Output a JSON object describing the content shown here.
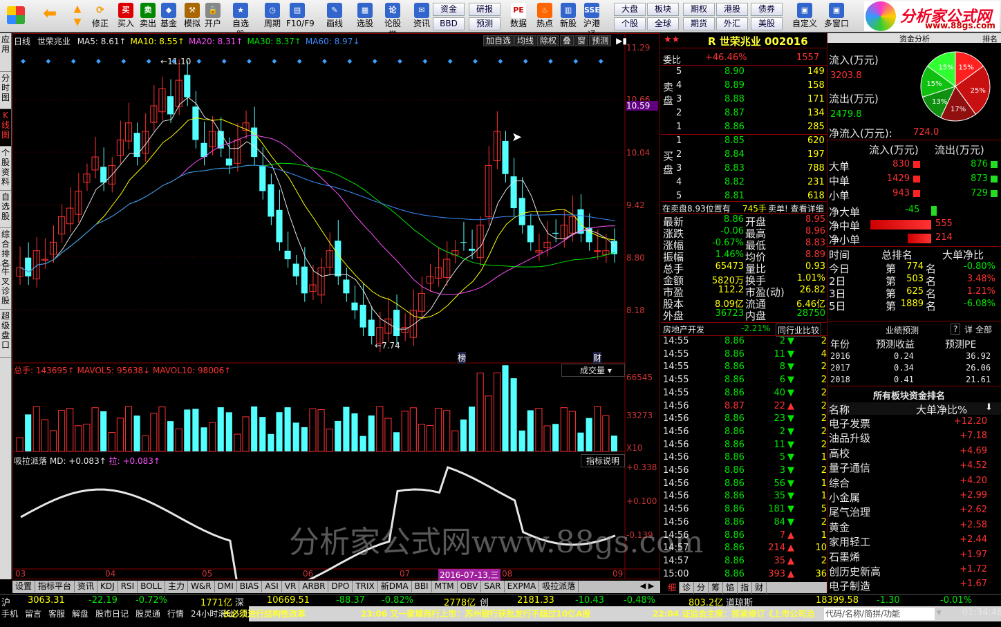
{
  "toolbar": {
    "buttons": [
      "买入",
      "卖出",
      "基金",
      "模拟",
      "开户",
      "自选股",
      "周期",
      "F10/F9",
      "画线",
      "选股",
      "论股堂",
      "资讯",
      "数据",
      "热点",
      "新股",
      "沪港通",
      "自定义",
      "多窗口"
    ],
    "back_label": "",
    "up": "",
    "fix": "修正",
    "small": [
      [
        "资金",
        "研报",
        "大盘",
        "板块",
        "期权",
        "港股",
        "债券"
      ],
      [
        "BBD",
        "预测",
        "个股",
        "全球",
        "期货",
        "外汇",
        "美股"
      ]
    ],
    "pe": "PE"
  },
  "logo": {
    "title": "分析家公式网",
    "url": "www.88gs.com"
  },
  "left_tabs": [
    "应用",
    "分时图",
    "K线图",
    "个股资料",
    "自选股",
    "综合排名",
    "牛叉诊股",
    "超级盘口"
  ],
  "chart": {
    "period": "日线",
    "name": "世荣兆业",
    "ma": [
      {
        "t": "MA5: 8.61↑",
        "c": "#e6e6e6"
      },
      {
        "t": "MA10: 8.55↑",
        "c": "#ffff00"
      },
      {
        "t": "MA20: 8.31↑",
        "c": "#ff50ff"
      },
      {
        "t": "MA30: 8.37↑",
        "c": "#00e600"
      },
      {
        "t": "MA60: 8.97↓",
        "c": "#3c8cff"
      }
    ],
    "top_btns": [
      "加自选",
      "均线",
      "除权",
      "叠",
      "窗",
      "预测"
    ],
    "yticks": [
      "11.29",
      "10.66",
      "10.59",
      "10.04",
      "9.42",
      "8.80",
      "8.18"
    ],
    "high": "11.10",
    "low": "7.74",
    "bang": "榜",
    "cai": "财",
    "vol_hdr": "总手: 143695↑ MAVOL5: 95638↓ MAVOL10: 98006↑",
    "vol_btn": "成交量",
    "vol_ticks": [
      "66545",
      "33273",
      "X10"
    ],
    "ind_hdr_name": "吸拉派落",
    "ind_md": "MD: +0.083↑",
    "ind_la": "拉: +0.083↑",
    "ind_btn": "指标说明",
    "ind_ticks": [
      "+0.338",
      "+0.100",
      "-0.139"
    ],
    "xticks": [
      "03",
      "04",
      "05",
      "06",
      "07",
      "08",
      "09"
    ],
    "cursor_date": "2016-07-13,三",
    "watermark": "分析家公式网www.88gs.com"
  },
  "quote": {
    "title": "世荣兆业",
    "code": "002016",
    "r": "R",
    "weibi_label": "委比",
    "weibi": "+46.46%",
    "weicha": "1557",
    "sell_label": "卖盘",
    "buy_label": "买盘",
    "sell": [
      [
        "5",
        "8.90",
        "149"
      ],
      [
        "4",
        "8.89",
        "158"
      ],
      [
        "3",
        "8.88",
        "171"
      ],
      [
        "2",
        "8.87",
        "134"
      ],
      [
        "1",
        "8.86",
        "285"
      ]
    ],
    "buy": [
      [
        "1",
        "8.85",
        "620"
      ],
      [
        "2",
        "8.84",
        "197"
      ],
      [
        "3",
        "8.83",
        "788"
      ],
      [
        "4",
        "8.82",
        "231"
      ],
      [
        "5",
        "8.81",
        "618"
      ]
    ],
    "note": "在卖盘8.93位置有",
    "note_amt": "745手",
    "note_tail": "卖单! 查看详细",
    "stats": [
      [
        "最新",
        "8.86",
        "开盘",
        "8.95"
      ],
      [
        "涨跌",
        "-0.06",
        "最高",
        "8.96"
      ],
      [
        "涨幅",
        "-0.67%",
        "最低",
        "8.83"
      ],
      [
        "振幅",
        "1.46%",
        "均价",
        "8.89"
      ],
      [
        "总手",
        "65473",
        "量比",
        "0.93"
      ],
      [
        "金额",
        "5820万",
        "换手",
        "1.01%"
      ],
      [
        "市盈",
        "112.2",
        "市盈(动)",
        "26.82"
      ],
      [
        "股本",
        "8.09亿",
        "流通",
        "6.46亿"
      ],
      [
        "外盘",
        "36723",
        "内盘",
        "28750"
      ]
    ],
    "industry": "房地产开发",
    "industry_chg": "-2.21%",
    "compare": "同行业比较",
    "ticks": [
      [
        "14:55",
        "8.86",
        "2",
        "d",
        "2"
      ],
      [
        "14:55",
        "8.86",
        "11",
        "d",
        "4"
      ],
      [
        "14:55",
        "8.86",
        "8",
        "d",
        "2"
      ],
      [
        "14:55",
        "8.86",
        "6",
        "d",
        "2"
      ],
      [
        "14:55",
        "8.86",
        "40",
        "d",
        "2"
      ],
      [
        "14:56",
        "8.87",
        "22",
        "u",
        "2"
      ],
      [
        "14:56",
        "8.86",
        "23",
        "d",
        "2"
      ],
      [
        "14:56",
        "8.86",
        "2",
        "d",
        "2"
      ],
      [
        "14:56",
        "8.86",
        "11",
        "d",
        "2"
      ],
      [
        "14:56",
        "8.86",
        "5",
        "d",
        "1"
      ],
      [
        "14:56",
        "8.86",
        "3",
        "d",
        "2"
      ],
      [
        "14:56",
        "8.86",
        "56",
        "d",
        "1"
      ],
      [
        "14:56",
        "8.86",
        "35",
        "d",
        "1"
      ],
      [
        "14:56",
        "8.86",
        "181",
        "d",
        "5"
      ],
      [
        "14:56",
        "8.86",
        "84",
        "d",
        "2"
      ],
      [
        "14:56",
        "8.86",
        "7",
        "u",
        "1"
      ],
      [
        "14:57",
        "8.86",
        "214",
        "u",
        "10"
      ],
      [
        "14:57",
        "8.86",
        "35",
        "u",
        "2"
      ],
      [
        "15:00",
        "8.86",
        "393",
        "u",
        "36"
      ]
    ],
    "bottom_tabs": [
      "细",
      "诊",
      "分",
      "筹",
      "馅",
      "指",
      "财"
    ]
  },
  "fund": {
    "title": "资金分析",
    "tab2": "排名",
    "in_label": "流入(万元)",
    "in_val": "3203.8",
    "out_label": "流出(万元)",
    "out_val": "2479.8",
    "net_label": "净流入(万元):",
    "net_val": "724.0",
    "pie": [
      {
        "v": 15,
        "c": "#ff2020"
      },
      {
        "v": 25,
        "c": "#c81010"
      },
      {
        "v": 17,
        "c": "#901010"
      },
      {
        "v": 13,
        "c": "#109010"
      },
      {
        "v": 15,
        "c": "#10c010"
      },
      {
        "v": 15,
        "c": "#30ff30"
      }
    ],
    "pie_labels": [
      "15%",
      "25%",
      "17%",
      "13%",
      "15%",
      "15%"
    ],
    "hdr_in": "流入(万元)",
    "hdr_out": "流出(万元)",
    "rows": [
      [
        "大单",
        "830",
        "876"
      ],
      [
        "中单",
        "1429",
        "873"
      ],
      [
        "小单",
        "943",
        "729"
      ]
    ],
    "net": [
      [
        "净大单",
        "-45"
      ],
      [
        "净中单",
        "555"
      ],
      [
        "净小单",
        "214"
      ]
    ],
    "rank_hdr": [
      "时间",
      "总排名",
      "大单净比"
    ],
    "rank": [
      [
        "今日",
        "第",
        "774",
        "名",
        "-0.80%"
      ],
      [
        "2日",
        "第",
        "503",
        "名",
        "3.48%"
      ],
      [
        "3日",
        "第",
        "625",
        "名",
        "1.21%"
      ],
      [
        "5日",
        "第",
        "1889",
        "名",
        "-6.08%"
      ]
    ],
    "forecast_title": "业绩预测",
    "fc_q": "?",
    "fc_d": "详",
    "fc_all": "全部",
    "fc_hdr": [
      "年份",
      "预测收益",
      "预测PE"
    ],
    "fc": [
      [
        "2016",
        "0.24",
        "36.92"
      ],
      [
        "2017",
        "0.34",
        "26.06"
      ],
      [
        "2018",
        "0.41",
        "21.61"
      ]
    ],
    "sector_title": "所有板块资金排名",
    "sector_hdr": [
      "名称",
      "大单净比%"
    ],
    "sectors": [
      [
        "电子发票",
        "+12.20"
      ],
      [
        "油品升级",
        "+7.18"
      ],
      [
        "高校",
        "+4.69"
      ],
      [
        "量子通信",
        "+4.52"
      ],
      [
        "综合",
        "+4.20"
      ],
      [
        "小金属",
        "+2.99"
      ],
      [
        "尾气治理",
        "+2.62"
      ],
      [
        "黄金",
        "+2.58"
      ],
      [
        "家用轻工",
        "+2.44"
      ],
      [
        "石墨烯",
        "+1.97"
      ],
      [
        "创历史新高",
        "+1.72"
      ],
      [
        "电子制造",
        "+1.67"
      ]
    ]
  },
  "bottom_tabs": [
    "设置",
    "指标平台",
    "资讯",
    "KDJ",
    "RSI",
    "BOLL",
    "主力",
    "W&R",
    "DMI",
    "BIAS",
    "ASI",
    "VR",
    "ARBR",
    "DPO",
    "TRIX",
    "新DMA",
    "BBI",
    "MTM",
    "OBV",
    "SAR",
    "EXPMA",
    "吸拉派落"
  ],
  "status": {
    "sh": "沪",
    "sh_v": "3063.31",
    "sh_c": "-22.19",
    "sh_p": "-0.72%",
    "sh_a": "1771亿",
    "sz": "深",
    "sz_v": "10669.51",
    "sz_c": "-88.37",
    "sz_p": "-0.82%",
    "sz_a": "2778亿",
    "cy": "创",
    "cy_v": "2181.33",
    "cy_c": "-10.43",
    "cy_p": "-0.48%",
    "cy_a": "803.2亿",
    "dq": "道琼斯",
    "dq_v": "18399.58",
    "dq_c": "-1.30",
    "dq_p": "-0.01%"
  },
  "status2": {
    "items": [
      "手机",
      "留言",
      "客服",
      "解盘",
      "股市日记",
      "股灵通",
      "行情",
      "24小时滚动"
    ],
    "news1": "长必须进行结构性改革",
    "news2": "23:06 又一家城商行上市：苏州银行获批发行不超过10亿A股",
    "news3": "22:04 证监会主席：抓紧修订《上市公司治",
    "search": "代码/名称/简拼/功能",
    "time": "01:34:48"
  }
}
